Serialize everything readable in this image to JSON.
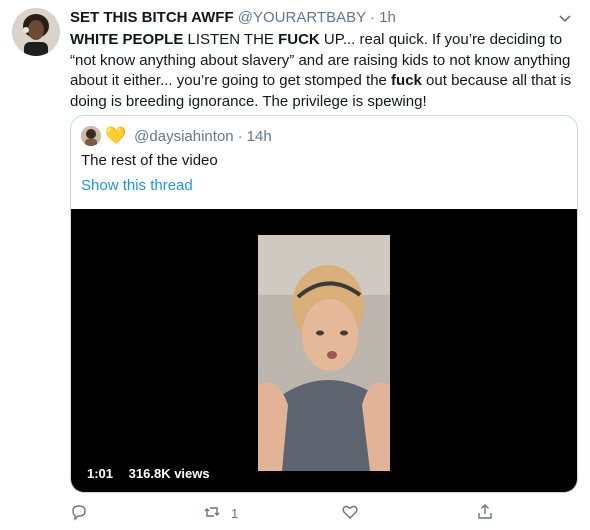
{
  "tweet": {
    "display_name": "SET THIS BITCH AWFF",
    "handle": "@YOURARTBABY",
    "separator": "·",
    "time": "1h",
    "text_parts": {
      "p1": "WHITE PEOPLE",
      "p2": " LISTEN THE ",
      "p3": "FUCK",
      "p4": " UP... real quick. If you’re deciding to “not know anything about slavery” and are raising kids to not know anything about it either... you’re going to get stomped the ",
      "p5": "fuck",
      "p6": " out because all that is doing is breeding ignorance. The privilege is spewing!"
    }
  },
  "quoted": {
    "heart": "💛",
    "handle": "@daysiahinton",
    "separator": "·",
    "time": "14h",
    "text": "The rest of the video",
    "link": "Show this thread",
    "video": {
      "duration": "1:01",
      "views": "316.8K views"
    }
  },
  "actions": {
    "retweet_count": "1"
  },
  "colors": {
    "link": "#1b95e0",
    "muted": "#657786",
    "heart": "#ffcc4d"
  },
  "icons": [
    "chevron-down-icon",
    "reply-icon",
    "retweet-icon",
    "like-icon",
    "share-icon"
  ]
}
